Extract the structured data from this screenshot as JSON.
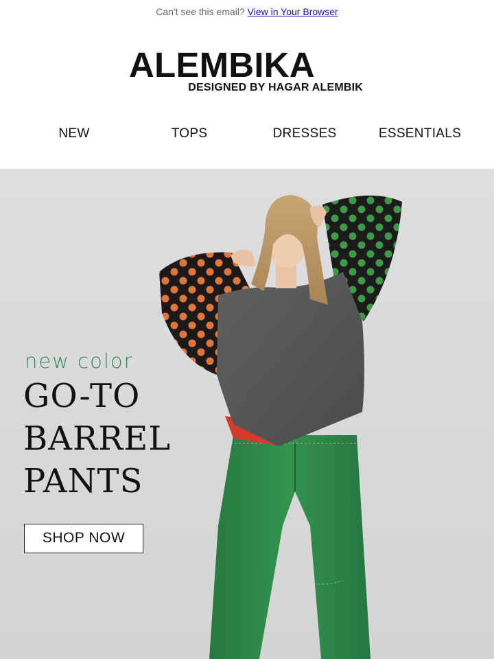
{
  "preheader": {
    "text": "Can't see this email?",
    "link_label": "View in Your Browser"
  },
  "brand": {
    "name": "ALEMBIKA",
    "tagline": "DESIGNED BY HAGAR ALEMBIK"
  },
  "nav": {
    "items": [
      {
        "label": "NEW"
      },
      {
        "label": "TOPS"
      },
      {
        "label": "DRESSES"
      },
      {
        "label": "ESSENTIALS"
      }
    ]
  },
  "hero": {
    "eyebrow": "new color",
    "headline_lines": [
      "GO-TO",
      "BARREL",
      "PANTS"
    ],
    "cta_label": "SHOP NOW",
    "image": "model-photo",
    "colors": {
      "eyebrow": "#2f8a5e",
      "background": "#d9d9d9",
      "pants": "#2f8a4a",
      "sweater": "#555757",
      "polka_orange": "#e0773a",
      "polka_green": "#3f9a48"
    }
  }
}
